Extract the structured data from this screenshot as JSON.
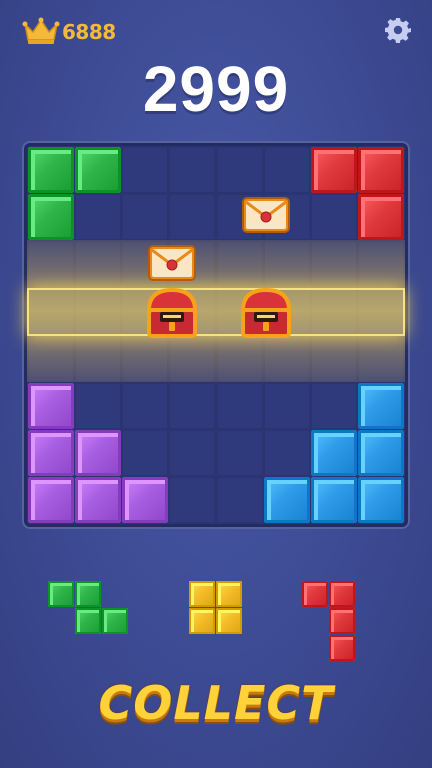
{
  "header": {
    "best_score": "6888",
    "score": "2999",
    "crown_icon": "crown-icon",
    "settings_icon": "gear-icon"
  },
  "colors": {
    "green": "#2fb54a",
    "red": "#e03a3e",
    "purple": "#a85ee0",
    "blue": "#2f9be8",
    "yellow": "#f6bd2b",
    "gold_text": "#f5b93a"
  },
  "board": {
    "size": 8,
    "rows": [
      [
        "green",
        "green",
        "",
        "",
        "",
        "",
        "red",
        "red"
      ],
      [
        "green",
        "",
        "",
        "",
        "",
        "",
        "",
        "red"
      ],
      [
        "",
        "",
        "",
        "",
        "",
        "",
        "",
        ""
      ],
      [
        "",
        "",
        "",
        "",
        "",
        "",
        "",
        ""
      ],
      [
        "",
        "",
        "",
        "",
        "",
        "",
        "",
        ""
      ],
      [
        "purple",
        "",
        "",
        "",
        "",
        "",
        "",
        "blue"
      ],
      [
        "purple",
        "purple",
        "",
        "",
        "",
        "",
        "blue",
        "blue"
      ],
      [
        "purple",
        "purple",
        "purple",
        "",
        "",
        "blue",
        "blue",
        "blue"
      ]
    ],
    "items": [
      {
        "type": "envelope",
        "row": 2,
        "col": 3
      },
      {
        "type": "envelope",
        "row": 1,
        "col": 5
      },
      {
        "type": "chest",
        "row": 3,
        "col": 3
      },
      {
        "type": "chest",
        "row": 3,
        "col": 5
      }
    ]
  },
  "pieces": [
    {
      "color": "green",
      "cells": [
        [
          0,
          0
        ],
        [
          0,
          1
        ],
        [
          1,
          1
        ],
        [
          1,
          2
        ]
      ]
    },
    {
      "color": "yellow",
      "cells": [
        [
          0,
          0
        ],
        [
          0,
          1
        ],
        [
          1,
          0
        ],
        [
          1,
          1
        ]
      ]
    },
    {
      "color": "red",
      "cells": [
        [
          0,
          0
        ],
        [
          0,
          1
        ],
        [
          1,
          1
        ],
        [
          2,
          1
        ]
      ]
    }
  ],
  "collect_label": "COLLECT"
}
